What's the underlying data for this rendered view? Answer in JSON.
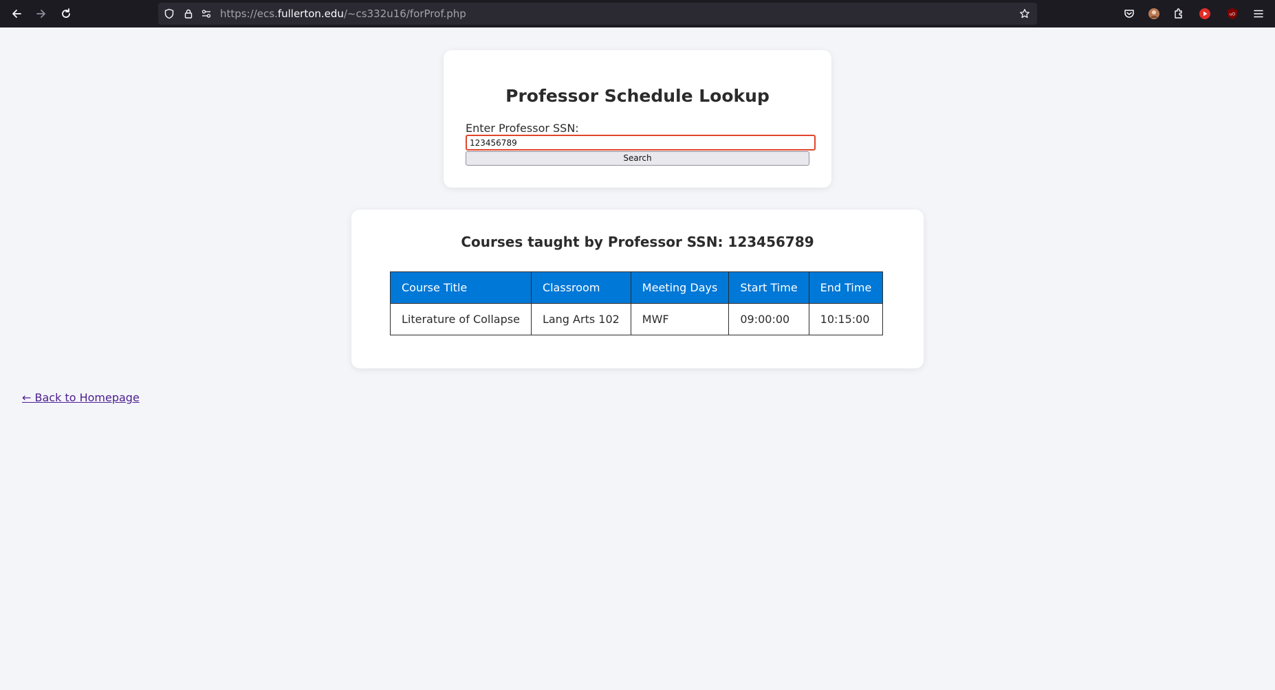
{
  "browser": {
    "url_prefix": "https://ecs.",
    "url_domain": "fullerton.edu",
    "url_path": "/~cs332u16/forProf.php"
  },
  "lookup": {
    "title": "Professor Schedule Lookup",
    "label": "Enter Professor SSN:",
    "input_value": "123456789",
    "search_label": "Search"
  },
  "results": {
    "title_prefix": "Courses taught by Professor SSN:",
    "title_ssn": "123456789",
    "columns": [
      "Course Title",
      "Classroom",
      "Meeting Days",
      "Start Time",
      "End Time"
    ],
    "rows": [
      [
        "Literature of Collapse",
        "Lang Arts 102",
        "MWF",
        "09:00:00",
        "10:15:00"
      ]
    ]
  },
  "footer": {
    "back_link": "← Back to Homepage"
  },
  "colors": {
    "header_blue": "#0078d7",
    "page_bg": "#f4f5f9",
    "input_border": "#e0452a",
    "link": "#4b1d8f"
  }
}
